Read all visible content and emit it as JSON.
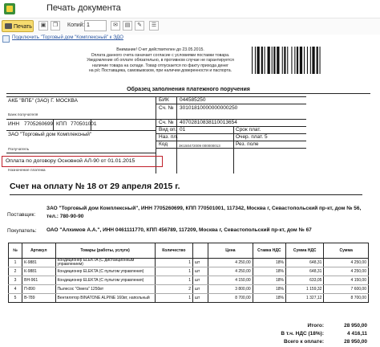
{
  "window": {
    "title": "Печать документа"
  },
  "toolbar": {
    "print_label": "Печать",
    "copies_label": "Копий:",
    "copies_value": "1"
  },
  "connect_link": "Подключить \"Торговый дом \"Комплексный\" к ЭДО",
  "notice": {
    "lines": [
      "Внимание! Счет действителен до 23.05.2015.",
      "Оплата данного счета означает согласие с условиями поставки товара.",
      "Уведомление об оплате обязательно, в противном случае не гарантируется",
      "наличие товара на складе. Товар отпускается по факту прихода денег",
      "на р/с Поставщика, самовывозом, при наличии доверенности и паспорта."
    ]
  },
  "sample": {
    "title": "Образец заполнения платежного поручения",
    "bank_name": "АКБ \"ВПБ\" (ЗАО) Г. МОСКВА",
    "bank_label": "Банк получателя",
    "bik_label": "БИК",
    "bik_value": "044585250",
    "acc_label": "Сч. №",
    "acc_value": "30101810000000000250",
    "inn_label": "ИНН",
    "inn_value": "7705260699",
    "kpp_label": "КПП",
    "kpp_value": "770501001",
    "acc2_label": "Сч. №",
    "acc2_value": "40702810838110013654",
    "recipient_name": "ЗАО \"Торговый дом Комплексный\"",
    "recipient_label": "Получатель",
    "vid_op_label": "Вид оп.",
    "vid_op_value": "01",
    "srok_label": "Срок плат.",
    "naz_label": "Наз. пл.",
    "order_label": "Очер. плат.",
    "order_value": "5",
    "code_label": "Код",
    "code_value": "3K150472009 000000013",
    "rez_label": "Рез. поле",
    "purpose_value": "Оплата по договору Основной АЛ-90 от 01.01.2015",
    "purpose_label": "Назначение платежа"
  },
  "invoice": {
    "title": "Счет на оплату № 18 от 29 апреля 2015 г.",
    "supplier_label": "Поставщик:",
    "supplier_value": "ЗАО \"Торговый дом Комплексный\", ИНН 7705260699, КПП 770501001, 117342, Москва г, Севастопольский пр-кт, дом № 56, тел.: 780-90-90",
    "buyer_label": "Покупатель:",
    "buyer_value": "ОАО \"Алхимов А.А.\", ИНН 0461111770, КПП 456789, 117209, Москва г, Севастопольский пр-кт, дом № 67"
  },
  "table": {
    "headers": [
      "№",
      "Артикул",
      "Товары (работы, услуги)",
      "Количество",
      "",
      "Цена",
      "Ставка НДС",
      "Сумма НДС",
      "Сумма"
    ],
    "rows": [
      {
        "n": "1",
        "art": "К-9881",
        "name": "Кондиционер ELEKTA (С дистанционным управлением)",
        "qty": "1",
        "unit": "шт",
        "price": "4 250,00",
        "rate": "18%",
        "vat": "648,31",
        "sum": "4 250,00"
      },
      {
        "n": "2",
        "art": "К-9881",
        "name": "Кондиционер ELEKTA (С пультом управления)",
        "qty": "1",
        "unit": "шт",
        "price": "4 250,00",
        "rate": "18%",
        "vat": "648,31",
        "sum": "4 250,00"
      },
      {
        "n": "3",
        "art": "ВН-961",
        "name": "Кондиционер ELEKTA (С пультом управления)",
        "qty": "1",
        "unit": "шт",
        "price": "4 150,00",
        "rate": "18%",
        "vat": "633,05",
        "sum": "4 150,00"
      },
      {
        "n": "4",
        "art": "П-890",
        "name": "Пылесос \"Омега\" 1250вт",
        "qty": "2",
        "unit": "шт",
        "price": "3 800,00",
        "rate": "18%",
        "vat": "1 159,32",
        "sum": "7 600,00"
      },
      {
        "n": "5",
        "art": "В-789",
        "name": "Вентилятор BINATONE ALPINE 160вт, напольный",
        "qty": "1",
        "unit": "шт",
        "price": "8 700,00",
        "rate": "18%",
        "vat": "1 327,12",
        "sum": "8 700,00"
      }
    ]
  },
  "totals": {
    "total_label": "Итого:",
    "total_value": "28 950,00",
    "vat_label": "В т.ч. НДС (18%):",
    "vat_value": "4 416,11",
    "to_pay_label": "Всего к оплате:",
    "to_pay_value": "28 950,00"
  }
}
